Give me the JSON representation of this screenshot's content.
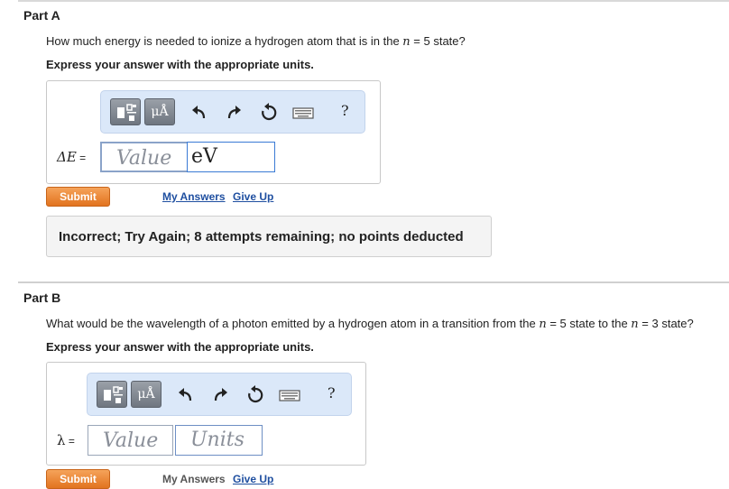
{
  "partA": {
    "title": "Part A",
    "question_pre": "How much energy is needed to ionize a hydrogen atom that is in the ",
    "question_var": "n",
    "question_post": " = 5 state?",
    "instruction": "Express your answer with the appropriate units.",
    "toolbar": {
      "units_label": "μÅ",
      "help": "?"
    },
    "label_var": "ΔE",
    "label_eq": " =",
    "value_placeholder": "Value",
    "unit_value": "eV",
    "submit": "Submit",
    "my_answers": "My Answers",
    "give_up": "Give Up",
    "feedback": "Incorrect; Try Again; 8 attempts remaining; no points deducted"
  },
  "partB": {
    "title": "Part B",
    "question_pre": "What would be the wavelength of a photon emitted by a hydrogen atom in a transition from the ",
    "question_var1": "n",
    "question_mid": " = 5 state to the ",
    "question_var2": "n",
    "question_post": " = 3 state?",
    "instruction": "Express your answer with the appropriate units.",
    "toolbar": {
      "units_label": "μÅ",
      "help": "?"
    },
    "label_var": "λ",
    "label_eq": " =",
    "value_placeholder": "Value",
    "unit_placeholder": "Units",
    "submit": "Submit",
    "my_answers": "My Answers",
    "give_up": "Give Up"
  },
  "colors": {
    "submit_bg": "#e8852c",
    "toolbar_bg": "#dbe8f9",
    "input_border": "#3a7bd5",
    "link": "#1f4fa0"
  },
  "icons": [
    "template-icon",
    "units-icon",
    "undo-icon",
    "redo-icon",
    "reset-icon",
    "keyboard-icon",
    "help-icon"
  ]
}
